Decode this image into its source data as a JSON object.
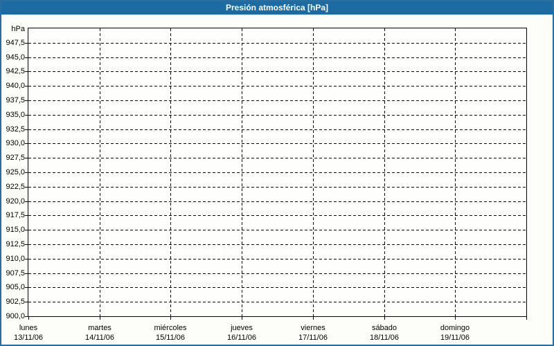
{
  "window": {
    "title": "Presión atmosférica [hPa]"
  },
  "colors": {
    "header_bg": "#1c6ba3",
    "frame_border": "#2a6d9e",
    "page_bg": "#fdfefa",
    "plot_bg": "#fefefc",
    "grid": "#000000",
    "title_text": "#ffffff",
    "label_text": "#000000"
  },
  "chart_data": {
    "type": "line",
    "title": "Presión atmosférica [hPa]",
    "unit": "hPa",
    "ylim": [
      900,
      950
    ],
    "ytick_step": 2.5,
    "grid": "dashed",
    "legend": null,
    "series": [],
    "yticks": [
      {
        "value": 947.5,
        "label": "947,5"
      },
      {
        "value": 945.0,
        "label": "945,0"
      },
      {
        "value": 942.5,
        "label": "942,5"
      },
      {
        "value": 940.0,
        "label": "940,0"
      },
      {
        "value": 937.5,
        "label": "937,5"
      },
      {
        "value": 935.0,
        "label": "935,0"
      },
      {
        "value": 932.5,
        "label": "932,5"
      },
      {
        "value": 930.0,
        "label": "930,0"
      },
      {
        "value": 927.5,
        "label": "927,5"
      },
      {
        "value": 925.0,
        "label": "925,0"
      },
      {
        "value": 922.5,
        "label": "922,5"
      },
      {
        "value": 920.0,
        "label": "920,0"
      },
      {
        "value": 917.5,
        "label": "917,5"
      },
      {
        "value": 915.0,
        "label": "915,0"
      },
      {
        "value": 912.5,
        "label": "912,5"
      },
      {
        "value": 910.0,
        "label": "910,0"
      },
      {
        "value": 907.5,
        "label": "907,5"
      },
      {
        "value": 905.0,
        "label": "905,0"
      },
      {
        "value": 902.5,
        "label": "902,5"
      },
      {
        "value": 900.0,
        "label": "900,0"
      }
    ],
    "categories": [
      {
        "day": "lunes",
        "date": "13/11/06"
      },
      {
        "day": "martes",
        "date": "14/11/06"
      },
      {
        "day": "miércoles",
        "date": "15/11/06"
      },
      {
        "day": "jueves",
        "date": "16/11/06"
      },
      {
        "day": "viernes",
        "date": "17/11/06"
      },
      {
        "day": "sábado",
        "date": "18/11/06"
      },
      {
        "day": "domingo",
        "date": "19/11/06"
      }
    ]
  }
}
